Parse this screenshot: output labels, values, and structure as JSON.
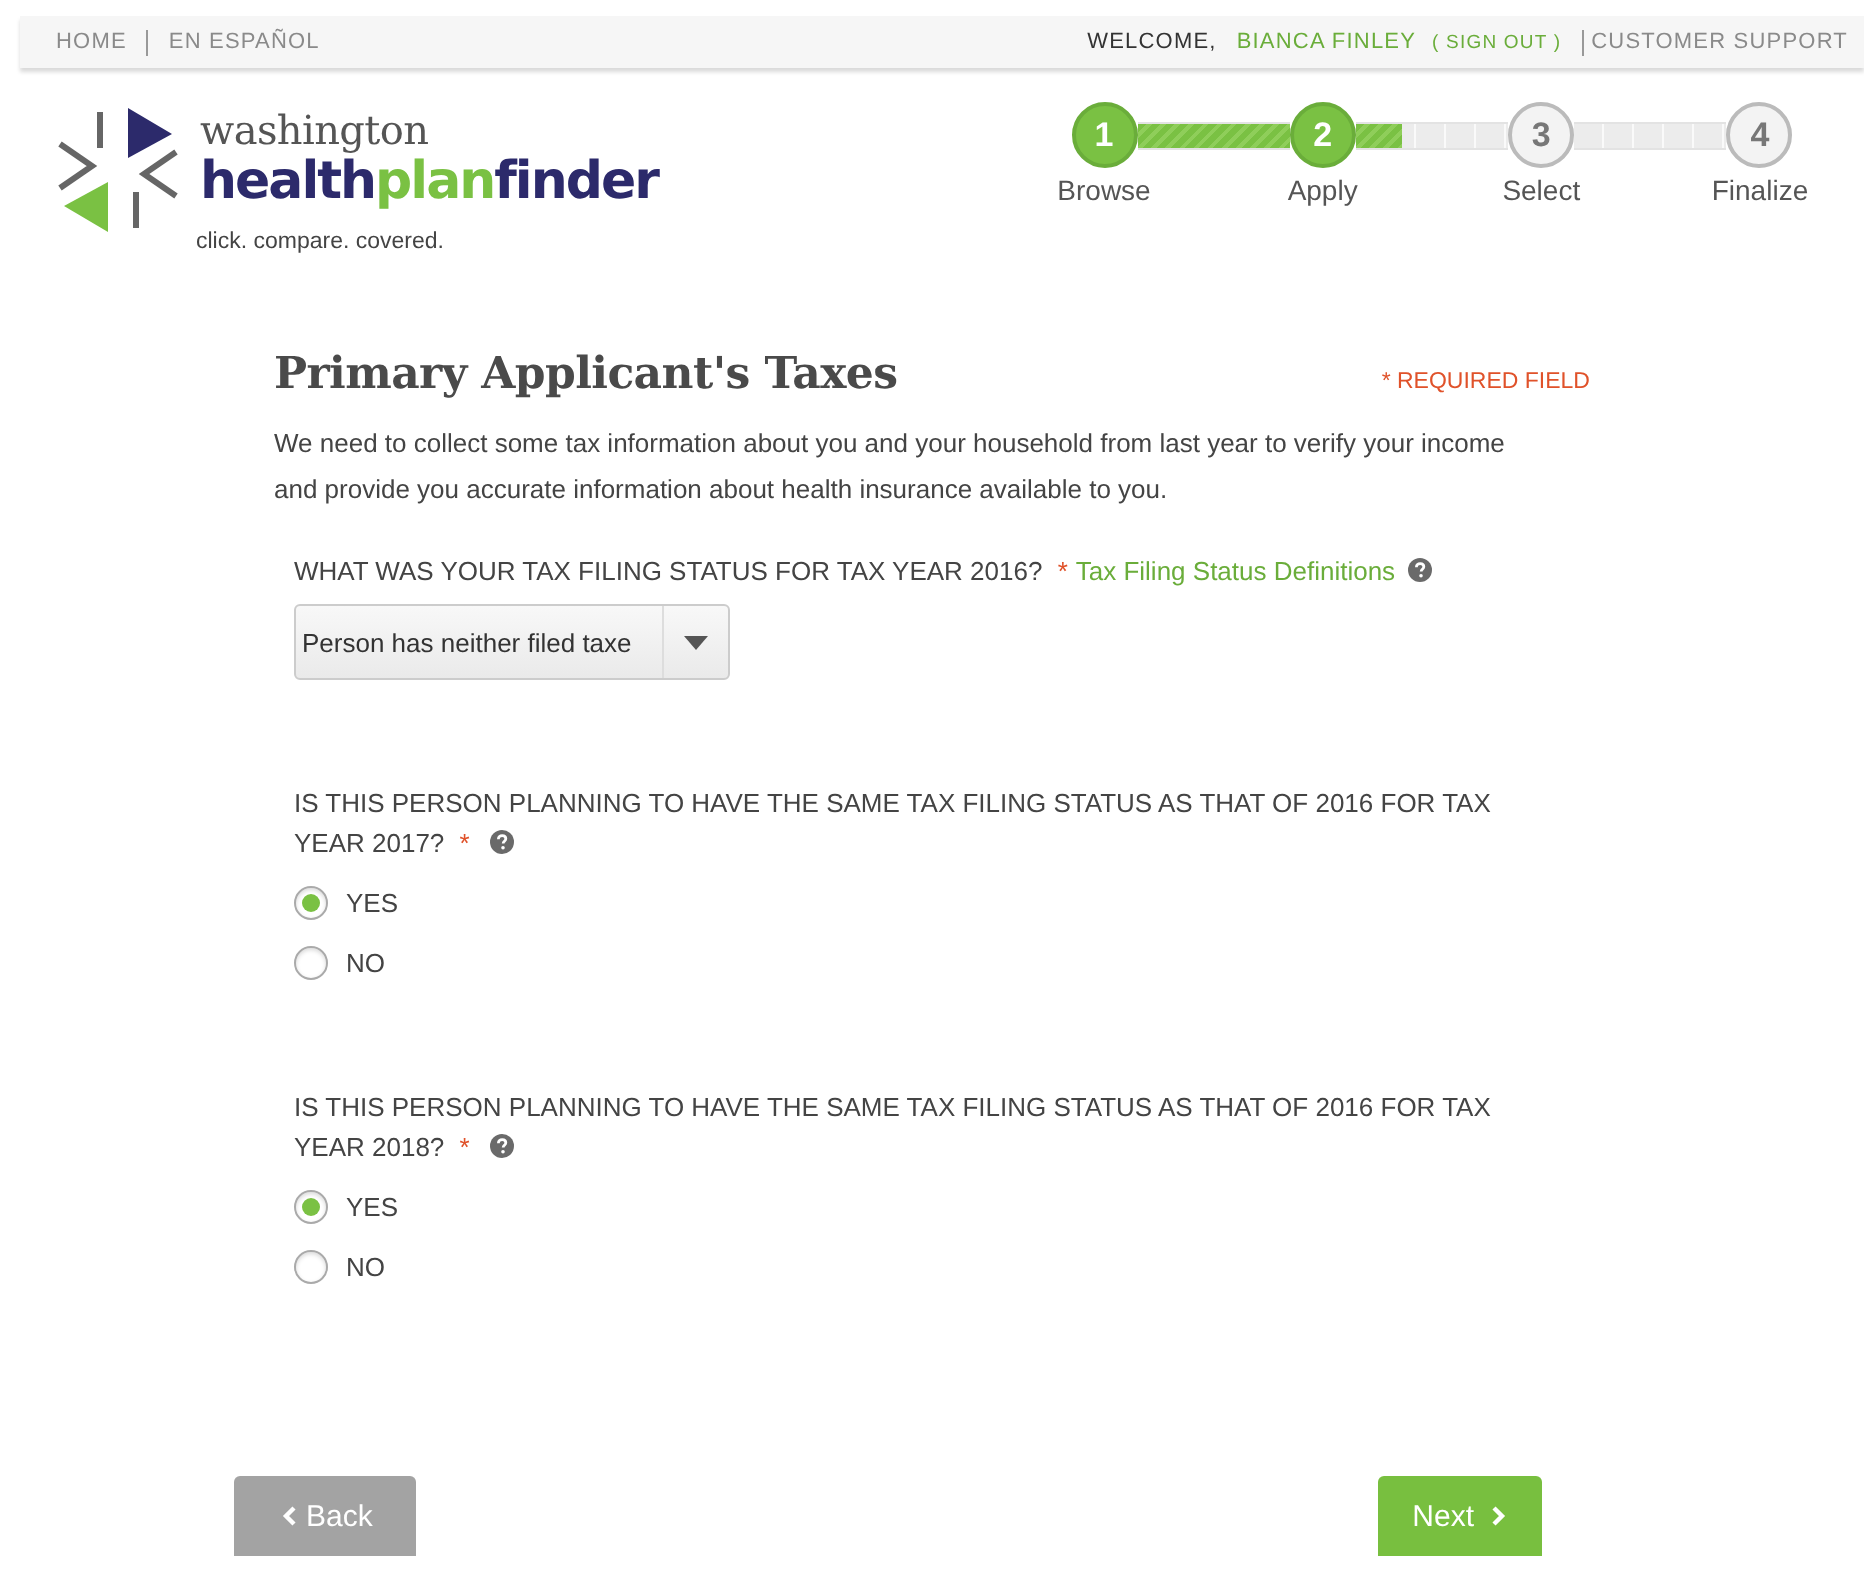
{
  "top_bar": {
    "left_links": [
      "HOME",
      "EN ESPAÑOL"
    ],
    "welcome": "WELCOME,",
    "user_name": "BIANCA FINLEY",
    "sign_out": "( SIGN OUT )",
    "support": "CUSTOMER SUPPORT"
  },
  "logo": {
    "line1": "washington",
    "name_parts": [
      "health",
      "plan",
      "finder"
    ],
    "tagline": "click. compare. covered."
  },
  "progress": {
    "segments": [
      {
        "level": 1
      },
      {
        "level": 0.3
      }
    ],
    "steps": [
      {
        "number": "1",
        "label": "Browse",
        "done": true
      },
      {
        "number": "2",
        "label": "Apply",
        "done": true
      },
      {
        "number": "3",
        "label": "Select",
        "done": false
      },
      {
        "number": "4",
        "label": "Finalize",
        "done": false
      }
    ]
  },
  "title": "Primary Applicant's Taxes",
  "required_note": "* REQUIRED FIELD",
  "intro": "We need to collect some tax information about you and your household from last year to verify your income and provide you accurate information about health insurance available to you.",
  "questions": [
    {
      "kind": "select",
      "label": "WHAT WAS YOUR TAX FILING STATUS FOR TAX YEAR 2016?",
      "required": "*",
      "help_link": "Tax Filing Status Definitions",
      "value": "Person has neither filed taxe"
    },
    {
      "kind": "radio",
      "label": "IS THIS PERSON PLANNING TO HAVE THE SAME TAX FILING STATUS AS THAT OF 2016 FOR TAX YEAR 2017?",
      "required": "*",
      "options": [
        {
          "label": "YES",
          "selected": true
        },
        {
          "label": "NO",
          "selected": false
        }
      ]
    },
    {
      "kind": "radio",
      "label": "IS THIS PERSON PLANNING TO HAVE THE SAME TAX FILING STATUS AS THAT OF 2016 FOR TAX YEAR 2018?",
      "required": "*",
      "options": [
        {
          "label": "YES",
          "selected": true
        },
        {
          "label": "NO",
          "selected": false
        }
      ]
    }
  ],
  "buttons": {
    "back": "Back",
    "next": "Next"
  }
}
